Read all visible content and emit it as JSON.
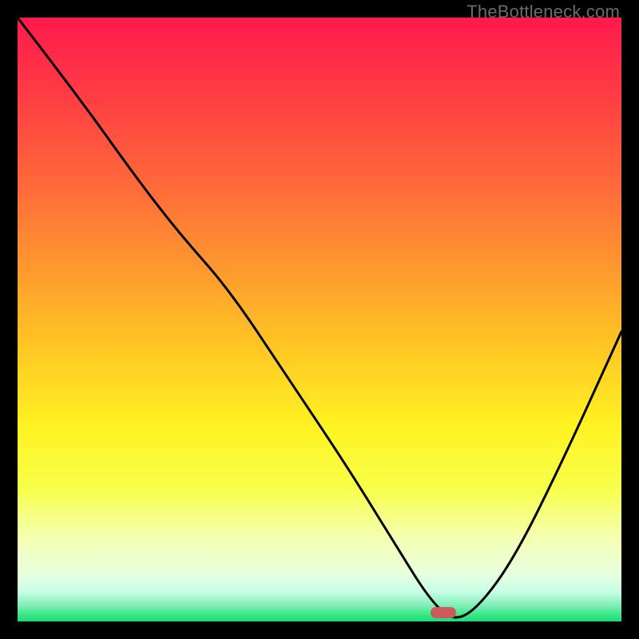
{
  "watermark": "TheBottleneck.com",
  "marker": {
    "x_frac": 0.705,
    "y_frac": 0.985,
    "color": "#cc5a5a"
  },
  "chart_data": {
    "type": "line",
    "title": "",
    "xlabel": "",
    "ylabel": "",
    "xlim": [
      0,
      1
    ],
    "ylim": [
      0,
      1
    ],
    "series": [
      {
        "name": "bottleneck-curve",
        "x": [
          0.0,
          0.1,
          0.2,
          0.27,
          0.35,
          0.45,
          0.55,
          0.63,
          0.68,
          0.72,
          0.76,
          0.82,
          0.9,
          1.0
        ],
        "y": [
          1.0,
          0.87,
          0.73,
          0.64,
          0.55,
          0.4,
          0.25,
          0.12,
          0.04,
          0.0,
          0.02,
          0.1,
          0.26,
          0.48
        ]
      }
    ],
    "annotations": [
      {
        "type": "marker",
        "x": 0.705,
        "y": 0.0,
        "label": "optimal-point"
      }
    ],
    "gradient_bands": [
      {
        "pos": 0.0,
        "color": "#ff1a4d"
      },
      {
        "pos": 0.5,
        "color": "#ffd024"
      },
      {
        "pos": 0.8,
        "color": "#f8ff60"
      },
      {
        "pos": 1.0,
        "color": "#1ddc72"
      }
    ]
  }
}
